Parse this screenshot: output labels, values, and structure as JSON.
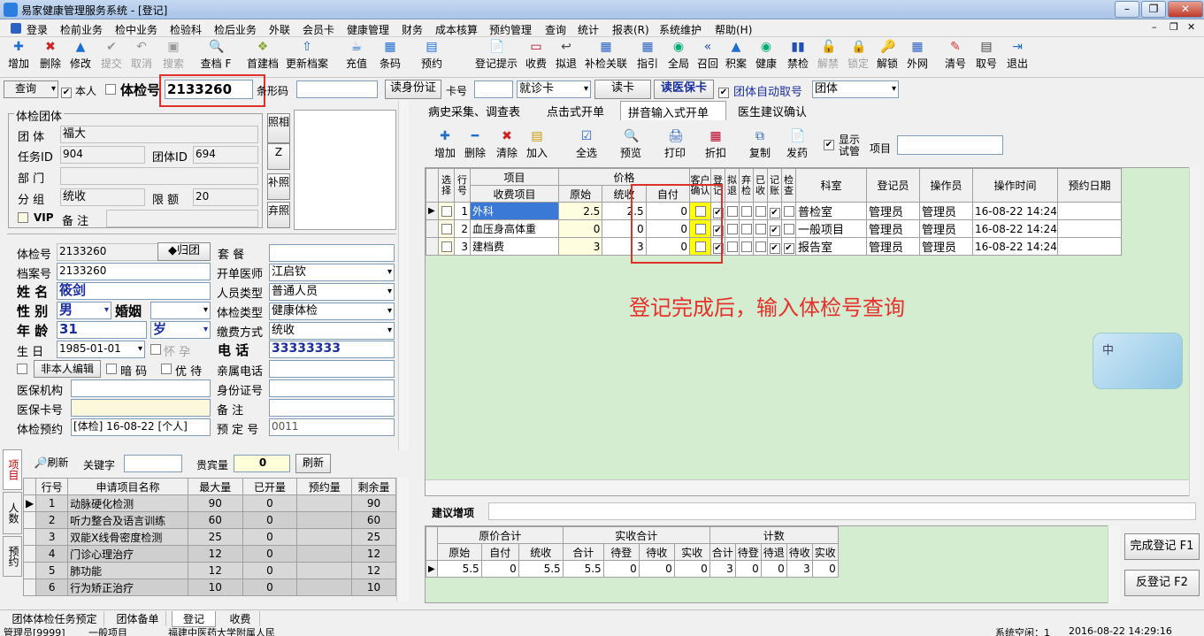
{
  "window": {
    "title": "易家健康管理服务系统 - [登记]",
    "min": "0",
    "restore": "1",
    "close": "r"
  },
  "menu": [
    "登录",
    "检前业务",
    "检中业务",
    "检验科",
    "检后业务",
    "外联",
    "会员卡",
    "健康管理",
    "财务",
    "成本核算",
    "预约管理",
    "查询",
    "统计",
    "报表(R)",
    "系统维护",
    "帮助(H)"
  ],
  "toolbar": [
    "增加",
    "删除",
    "修改",
    "提交",
    "取消",
    "搜索",
    "查档 F",
    "首建档",
    "更新档案",
    "充值",
    "条码",
    "预约",
    "登记提示",
    "收费",
    "拟退",
    "补检关联",
    "指引",
    "全局",
    "召回",
    "积案",
    "健康",
    "禁检",
    "解禁",
    "锁定",
    "解锁",
    "外网",
    "清号",
    "取号",
    "退出"
  ],
  "search": {
    "mode": "查询",
    "self_label": "本人",
    "exam_no_label": "体检号",
    "exam_no": "2133260",
    "barcode_label": "条形码",
    "barcode": "",
    "read_id_btn": "读身份证",
    "card_no_label": "卡号",
    "card_no": "",
    "card_type": "就诊卡",
    "read_card_btn": "读卡",
    "read_medical_btn": "读医保卡",
    "auto_group_label": "团体自动取号",
    "group_type": "团体"
  },
  "group": {
    "legend": "体检团体",
    "team_label": "团 体",
    "team": "福大",
    "task_id_label": "任务ID",
    "task_id": "904",
    "group_id_label": "团体ID",
    "group_id": "694",
    "dept_label": "部 门",
    "dept": "",
    "sub_label": "分 组",
    "sub": "统收",
    "limit_label": "限 额",
    "limit": "20",
    "vip_label": "VIP",
    "remark_label": "备 注",
    "remark": ""
  },
  "side_buttons": [
    "照相",
    "Z",
    "补照",
    "弃照"
  ],
  "person": {
    "exam_no_label": "体检号",
    "exam_no": "2133260",
    "back_btn": "◆归团",
    "package_label": "套 餐",
    "package": "",
    "file_no_label": "档案号",
    "file_no": "2133260",
    "doctor_label": "开单医师",
    "doctor": "江启钦",
    "name_label": "姓 名",
    "name": "筱剑",
    "staff_type_label": "人员类型",
    "staff_type": "普通人员",
    "gender_label": "性 别",
    "gender": "男",
    "marital_label": "婚姻",
    "marital": "",
    "exam_type_label": "体检类型",
    "exam_type": "健康体检",
    "age_label": "年 龄",
    "age": "31",
    "age_unit": "岁",
    "pay_label": "缴费方式",
    "pay": "统收",
    "birth_label": "生 日",
    "birth": "1985-01-01",
    "pregnant_label": "怀 孕",
    "phone_label": "电 话",
    "phone": "33333333",
    "edit_btn": "非本人编辑",
    "secret_label": "暗 码",
    "priority_label": "优 待",
    "relative_phone_label": "亲属电话",
    "relative_phone": "",
    "insurer_label": "医保机构",
    "insurer": "",
    "idcard_label": "身份证号",
    "idcard": "",
    "insure_card_label": "医保卡号",
    "insure_card": "",
    "note_label": "备 注",
    "note": "",
    "appoint_label": "体检预约",
    "appoint": "[体检] 16-08-22 [个人]",
    "appoint_no_label": "预 定 号",
    "appoint_no": "0011"
  },
  "left_bottom": {
    "vtabs": [
      "项目",
      "人数",
      "预约"
    ],
    "refresh": "刷新",
    "keyword_label": "关键字",
    "keyword": "",
    "vip_label": "贵宾量",
    "vip": "0",
    "refresh2": "刷新",
    "columns": [
      "行号",
      "申请项目名称",
      "最大量",
      "已开量",
      "预约量",
      "剩余量"
    ],
    "rows": [
      [
        "1",
        "动脉硬化检测",
        "90",
        "0",
        "",
        "90"
      ],
      [
        "2",
        "听力整合及语言训练",
        "60",
        "0",
        "",
        "60"
      ],
      [
        "3",
        "双能X线骨密度检测",
        "25",
        "0",
        "",
        "25"
      ],
      [
        "4",
        "门诊心理治疗",
        "12",
        "0",
        "",
        "12"
      ],
      [
        "5",
        "肺功能",
        "12",
        "0",
        "",
        "12"
      ],
      [
        "6",
        "行为矫正治疗",
        "10",
        "0",
        "",
        "10"
      ]
    ]
  },
  "tabs": [
    "病史采集、调查表",
    "点击式开单",
    "拼音输入式开单",
    "医生建议确认"
  ],
  "item_toolbar": [
    "增加",
    "删除",
    "清除",
    "加入",
    "全选",
    "预览",
    "打印",
    "折扣",
    "复制",
    "发药"
  ],
  "show_trial_label": "显示试管",
  "item_label": "项目",
  "item_value": "",
  "grid": {
    "h_item": "项目",
    "h_price": "价格",
    "h_select": "选择",
    "h_row": "行号",
    "h_fee": "收费项目",
    "h_orig": "原始",
    "h_paid": "统收",
    "h_self": "自付",
    "h_confirm": "客户确认",
    "h_reg": "登记",
    "h_refund": "拟退",
    "h_abandon": "弃检",
    "h_collect": "已收",
    "h_account": "记账",
    "h_check": "检查",
    "h_dept": "科室",
    "h_registrar": "登记员",
    "h_operator": "操作员",
    "h_time": "操作时间",
    "h_appoint": "预约日期",
    "rows": [
      {
        "row": "1",
        "name": "外科",
        "orig": "2.5",
        "paid": "2.5",
        "self": "0",
        "dept": "普检室",
        "registrar": "管理员",
        "operator": "管理员",
        "time": "16-08-22 14:24"
      },
      {
        "row": "2",
        "name": "血压身高体重",
        "orig": "0",
        "paid": "0",
        "self": "0",
        "dept": "一般项目",
        "registrar": "管理员",
        "operator": "管理员",
        "time": "16-08-22 14:24"
      },
      {
        "row": "3",
        "name": "建档费",
        "orig": "3",
        "paid": "3",
        "self": "0",
        "dept": "报告室",
        "registrar": "管理员",
        "operator": "管理员",
        "time": "16-08-22 14:24"
      }
    ]
  },
  "annotation": "登记完成后，输入体检号查询",
  "ime": "中",
  "suggest_label": "建议增项",
  "summary": {
    "h1": "原价合计",
    "h2": "实收合计",
    "h3": "计数",
    "cols": [
      "原始",
      "自付",
      "统收",
      "合计",
      "待登",
      "待收",
      "实收",
      "合计",
      "待登",
      "待退",
      "待收",
      "实收"
    ],
    "values": [
      "5.5",
      "0",
      "5.5",
      "5.5",
      "0",
      "0",
      "0",
      "3",
      "0",
      "0",
      "3",
      "0"
    ]
  },
  "finish_btn": "完成登记 F1",
  "undo_btn": "反登记 F2",
  "bottom_tabs": [
    "团体体检任务预定",
    "团体备单",
    "登记",
    "收费"
  ],
  "status": [
    "管理员[9999]",
    "一般项目",
    "福建中医药大学附属人民",
    "系统空闲：1",
    "2016-08-22 14:29:16"
  ],
  "colors": {
    "annotation": "#e8302a",
    "highlight_box": "#e0302a",
    "green_panel": "#d4ecd0",
    "yellow_cell": "#ffff00"
  }
}
